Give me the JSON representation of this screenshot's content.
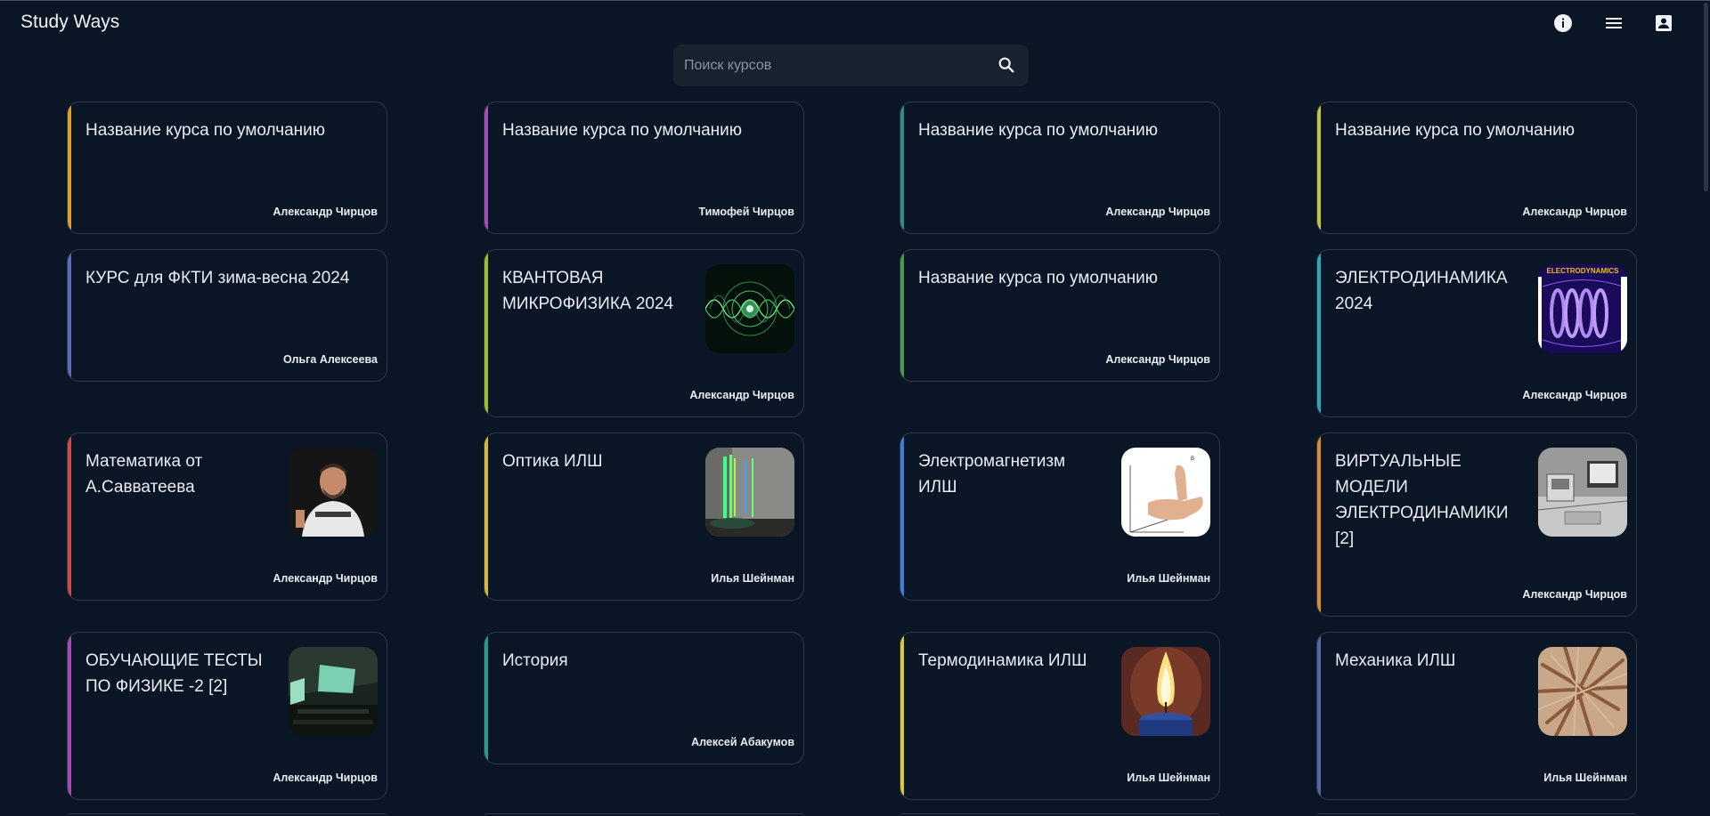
{
  "app": {
    "title": "Study Ways"
  },
  "header": {
    "icons": [
      "info-icon",
      "menu-icon",
      "account-box-icon"
    ]
  },
  "search": {
    "placeholder": "Поиск курсов",
    "value": ""
  },
  "colors": {
    "background": "#0a1626",
    "card_border": "#2e3a48",
    "accents": [
      "#e0a030",
      "#a14db8",
      "#2f8f86",
      "#c9c13a",
      "#5c6fb5",
      "#9bbf2f",
      "#4a9a4a",
      "#2aa8b5",
      "#d04a4a",
      "#d8b83a",
      "#3d7ed8",
      "#e08a2a",
      "#a04fb0",
      "#2a9a8a",
      "#d8c83a",
      "#5566a8"
    ]
  },
  "courses": [
    {
      "title": "Название курса по умолчанию",
      "author": "Александр Чирцов",
      "accent": "#e0a030"
    },
    {
      "title": "Название курса по умолчанию",
      "author": "Тимофей Чирцов",
      "accent": "#a14db8"
    },
    {
      "title": "Название курса по умолчанию",
      "author": "Александр Чирцов",
      "accent": "#2f8f86"
    },
    {
      "title": "Название курса по умолчанию",
      "author": "Александр Чирцов",
      "accent": "#c9c13a"
    },
    {
      "title": "КУРС для ФКТИ зима-весна 2024",
      "author": "Ольга Алексеева",
      "accent": "#5c6fb5"
    },
    {
      "title": "КВАНТОВАЯ МИКРОФИЗИКА 2024",
      "author": "Александр Чирцов",
      "accent": "#9bbf2f",
      "image": "quantum-waves-image"
    },
    {
      "title": "Название курса по умолчанию",
      "author": "Александр Чирцов",
      "accent": "#4a9a4a"
    },
    {
      "title": "ЭЛЕКТРОДИНАМИКА 2024",
      "author": "Александр Чирцов",
      "accent": "#2aa8b5",
      "image": "electrodynamics-image",
      "image_caption": "ELECTRODYNAMICS"
    },
    {
      "title": "Математика от А.Савватеева",
      "author": "Александр Чирцов",
      "accent": "#d04a4a",
      "image": "lecturer-photo"
    },
    {
      "title": "Оптика ИЛШ",
      "author": "Илья Шейнман",
      "accent": "#d8b83a",
      "image": "spectrum-image"
    },
    {
      "title": "Электромагнетизм ИЛШ",
      "author": "Илья Шейнман",
      "accent": "#3d7ed8",
      "image": "hand-rule-image"
    },
    {
      "title": "ВИРТУАЛЬНЫЕ МОДЕЛИ ЭЛЕКТРОДИНАМИКИ [2]",
      "author": "Александр Чирцов",
      "accent": "#e08a2a",
      "image": "lab-sketch-image"
    },
    {
      "title": "ОБУЧАЮЩИЕ ТЕСТЫ ПО ФИЗИКЕ -2 [2]",
      "author": "Александр Чирцов",
      "accent": "#a04fb0",
      "image": "lecture-hall-image"
    },
    {
      "title": "История",
      "author": "Алексей Абакумов",
      "accent": "#2a9a8a"
    },
    {
      "title": "Термодинамика ИЛШ",
      "author": "Илья Шейнман",
      "accent": "#d8c83a",
      "image": "candle-flame-image"
    },
    {
      "title": "Механика ИЛШ",
      "author": "Илья Шейнман",
      "accent": "#5566a8",
      "image": "wood-sticks-image"
    }
  ]
}
